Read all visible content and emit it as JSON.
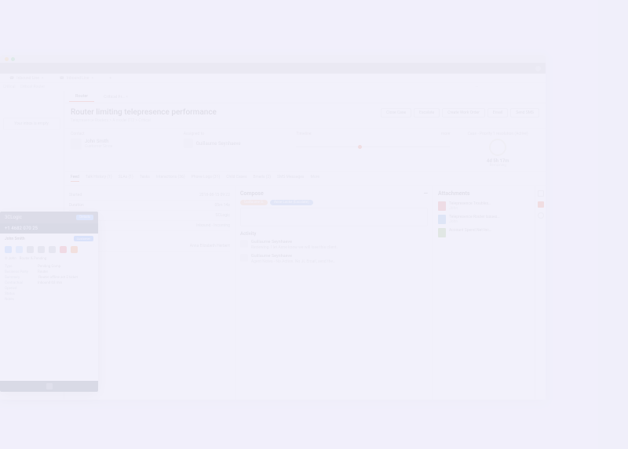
{
  "tabs1": [
    {
      "icon": "phone",
      "label": "Inbound Line",
      "closable": true
    },
    {
      "icon": "phone",
      "label": "Inbound Line",
      "closable": true
    }
  ],
  "subrow_left": [
    "Critical",
    "Critical Router"
  ],
  "sidebar": {
    "alert": "Your inbox is empty."
  },
  "case_tabs": [
    {
      "label": "Router",
      "closable": false
    },
    {
      "label": "Critical Fr…",
      "closable": true
    }
  ],
  "case": {
    "title": "Router limiting telepresence performance",
    "breadcrumb": "Telepresence Routers  > A model 012  >  Critical"
  },
  "actions": [
    "Close Case",
    "Escalate",
    "Create Work Order",
    "Email",
    "Send SMS"
  ],
  "info": {
    "contact_label": "Contact",
    "contact_name": "John Smith",
    "contact_sub": "Customer Since",
    "assigned_label": "Assigned to",
    "assigned_name": "Guillaume Seynhaeve",
    "timeline_label": "Timeline",
    "timeline_more": "more",
    "sla_label": "Case - Priority 1 resolution (Active)",
    "sla_time": "4d 5h 17m",
    "sla_status": "Remaining"
  },
  "navtabs": [
    "Feed",
    "Talk History (1)",
    "SLAs (1)",
    "Tasks",
    "Interactions (36)",
    "Phone Logs (31)",
    "Child Cases",
    "Emails (2)",
    "SMS Messages",
    "More"
  ],
  "navtabs_active": 0,
  "talk_rows": [
    {
      "l": "Started",
      "r": "2018-08-15 09:22"
    },
    {
      "l": "Duration",
      "r": "05m 14s"
    },
    {
      "l": "Agent",
      "r": "SCLogic"
    },
    {
      "l": "Workflow",
      "r": "Inbound - Incoming"
    },
    {
      "l": "Score",
      "r": ""
    },
    {
      "l": "Participant",
      "r": "Anna Elizabeth Herbert"
    }
  ],
  "compose": {
    "title": "Compose",
    "to_pill1": "Guillaume S.",
    "to_pill2": "Anne Locke (Escalate)"
  },
  "activity": {
    "title": "Activity",
    "items": [
      {
        "name": "Guillaume Seynhaeve",
        "text": "Reviewing. I let Anne know we will lose this client."
      },
      {
        "name": "Guillaume Seynhaeve",
        "text": "Agent Notes - No Action.\nNo JL Email, send the…"
      }
    ]
  },
  "attach": {
    "title": "Attachments",
    "files": [
      {
        "name": "Telepresence Troubles…",
        "type": "pdf",
        "meta": "John"
      },
      {
        "name": "Telepresence Router Issues…",
        "type": "doc",
        "meta": "John"
      },
      {
        "name": "Account Spend Net Inc…",
        "type": "xls",
        "meta": ""
      }
    ]
  },
  "popup": {
    "title": "3CLogic",
    "title_btn": "Details",
    "phone": "+1 4682 070 25",
    "caller_name": "John Smith",
    "badge": "Customer",
    "sub1": "© John",
    "sub2": "Router & Pending",
    "grid": [
      [
        "Type",
        "Pending Comp"
      ],
      [
        "Business Party",
        "Router"
      ],
      [
        "Summary",
        "-Router offline set 2 ticket"
      ],
      [
        "Contractual",
        "Inbound 62 min"
      ],
      [
        "Opened",
        ""
      ],
      [
        "Status",
        ""
      ],
      [
        "Notes",
        ""
      ]
    ]
  }
}
